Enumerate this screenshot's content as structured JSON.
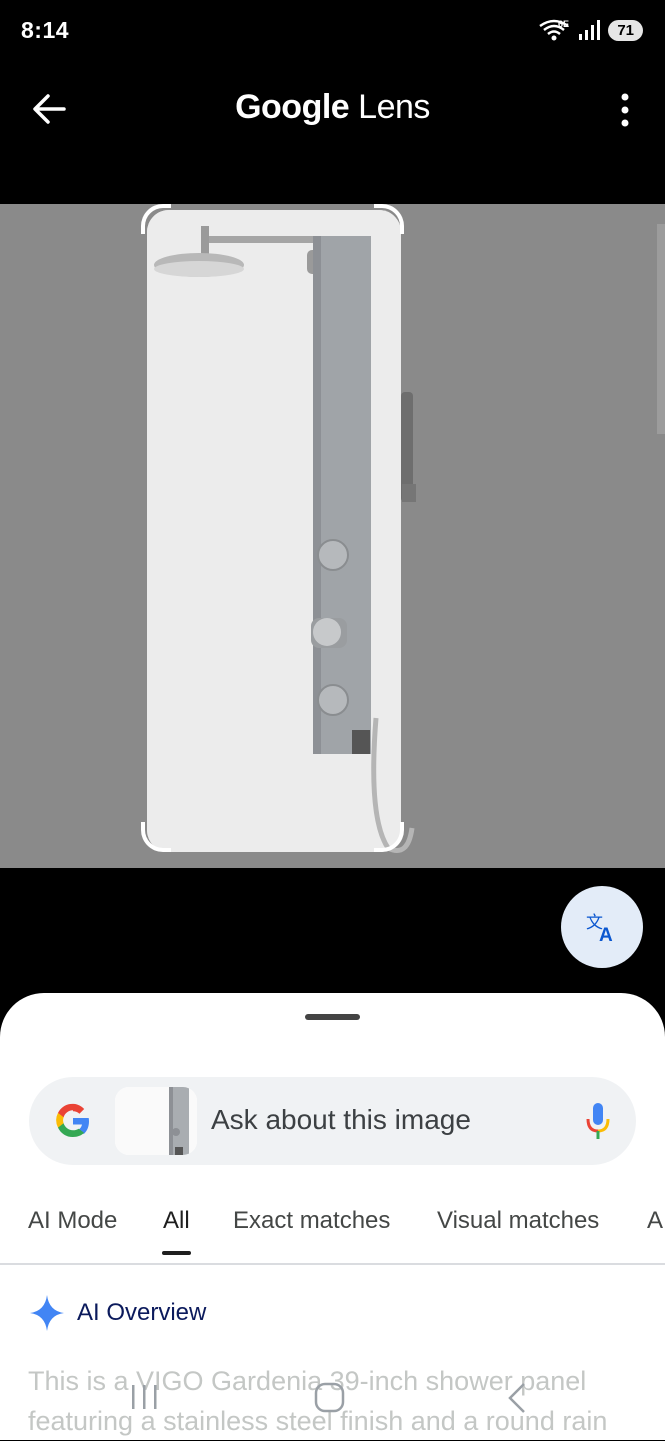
{
  "status": {
    "time": "8:14",
    "battery": "71",
    "network": "6E"
  },
  "topbar": {
    "title_google": "Google",
    "title_lens": "Lens"
  },
  "search": {
    "placeholder": "Ask about this image"
  },
  "tabs": [
    "AI Mode",
    "All",
    "Exact matches",
    "Visual matches",
    "A"
  ],
  "active_tab": "All",
  "ai_overview": {
    "label": "AI Overview",
    "text_line1": "This is a VIGO Gardenia 39-inch shower panel",
    "text_line2": "featuring a stainless steel finish and a round rain"
  },
  "icons": [
    "back-arrow-icon",
    "more-vert-icon",
    "translate-icon",
    "google-g-icon",
    "mic-icon",
    "sparkle-icon",
    "recents-icon",
    "home-icon",
    "nav-back-icon"
  ],
  "colors": {
    "sheet_bg": "#ffffff",
    "image_bg": "#8a8a8a",
    "accent_blue": "#4285f4",
    "translate_bg": "#e3ecf8"
  }
}
